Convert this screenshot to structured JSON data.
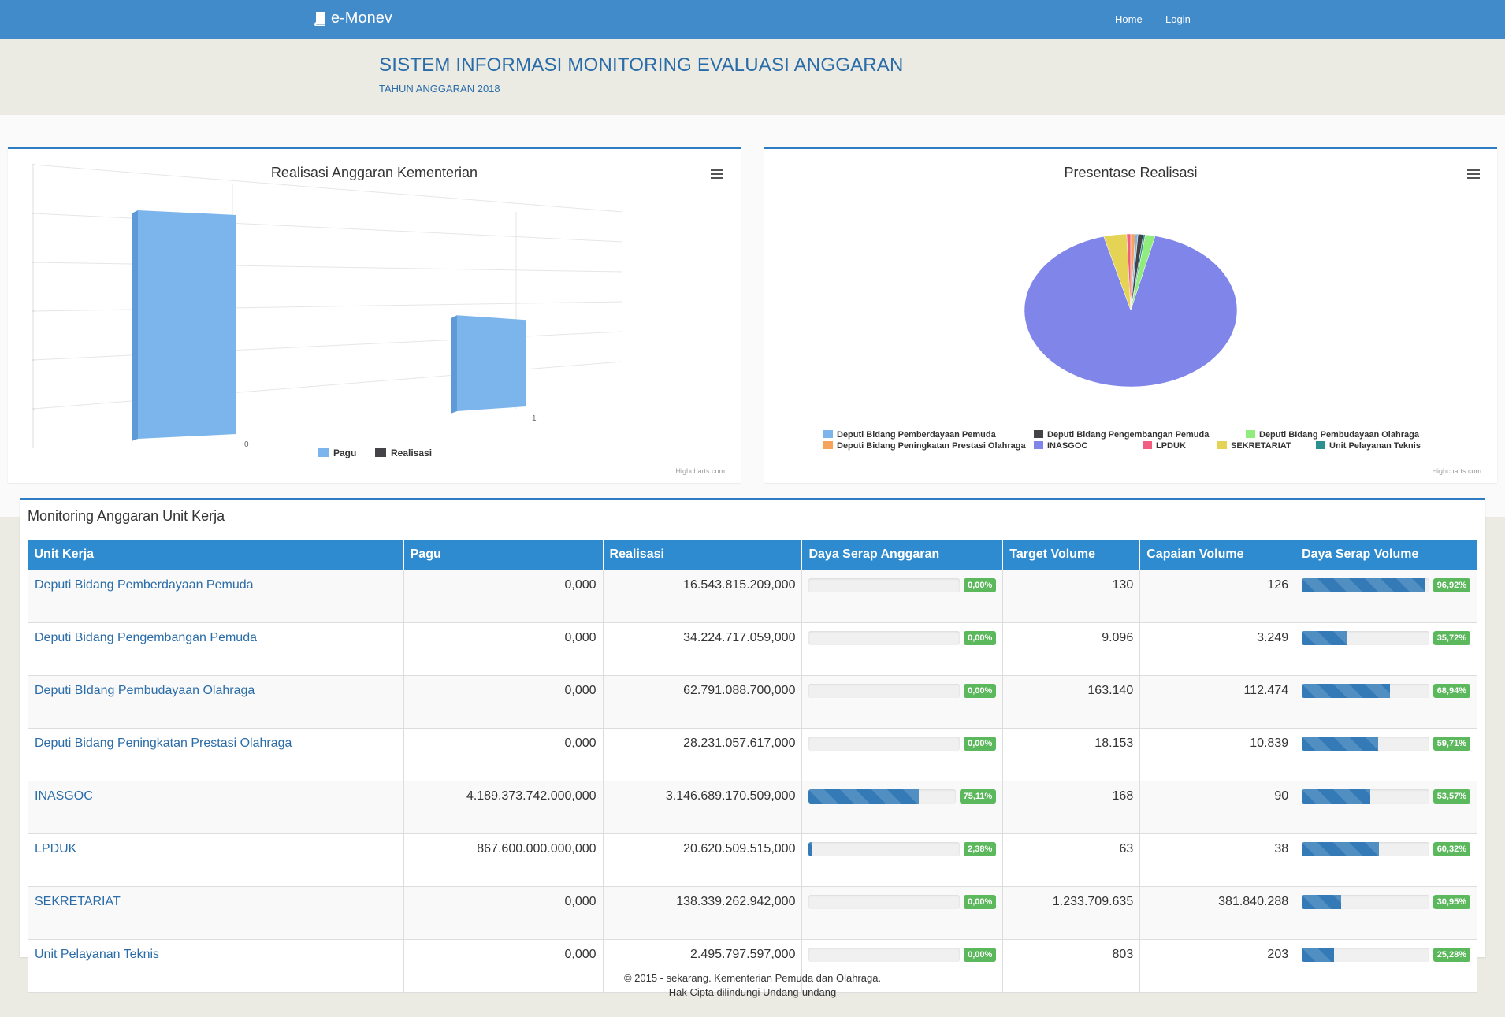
{
  "nav": {
    "brand": "e-Monev",
    "home": "Home",
    "login": "Login"
  },
  "header": {
    "title": "SISTEM INFORMASI MONITORING EVALUASI ANGGARAN",
    "subtitle": "TAHUN ANGGARAN 2018"
  },
  "chart_data": [
    {
      "type": "bar",
      "title": "Realisasi Anggaran Kementerian",
      "categories": [
        "0",
        "1"
      ],
      "series": [
        {
          "name": "Pagu",
          "color": "#7cb5ec",
          "values": [
            1.0,
            0
          ]
        },
        {
          "name": "Realisasi",
          "color": "#434348",
          "values": [
            0,
            0.6
          ]
        }
      ],
      "legend": "bottom-center",
      "credits": "Highcharts.com",
      "grid": true
    },
    {
      "type": "pie",
      "title": "Presentase Realisasi",
      "series": [
        {
          "name": "Deputi Bidang Pemberdayaan Pemuda",
          "color": "#7cb5ec",
          "value": 0.4
        },
        {
          "name": "Deputi Bidang Pengembangan Pemuda",
          "color": "#434348",
          "value": 0.8
        },
        {
          "name": "Deputi BIdang Pembudayaan Olahraga",
          "color": "#90ed7d",
          "value": 1.5
        },
        {
          "name": "Deputi Bidang Peningkatan Prestasi Olahraga",
          "color": "#f7a35c",
          "value": 0.7
        },
        {
          "name": "INASGOC",
          "color": "#8085e9",
          "value": 92.2
        },
        {
          "name": "LPDUK",
          "color": "#f15c80",
          "value": 0.6
        },
        {
          "name": "SEKRETARIAT",
          "color": "#e4d354",
          "value": 3.5
        },
        {
          "name": "Unit Pelayanan Teknis",
          "color": "#2b908f",
          "value": 0.3
        }
      ],
      "legend": "bottom-center",
      "credits": "Highcharts.com"
    }
  ],
  "table": {
    "title": "Monitoring Anggaran Unit Kerja",
    "headers": [
      "Unit Kerja",
      "Pagu",
      "Realisasi",
      "Daya Serap Anggaran",
      "Target Volume",
      "Capaian Volume",
      "Daya Serap Volume"
    ],
    "rows": [
      {
        "unit": "Deputi Bidang Pemberdayaan Pemuda",
        "pagu": "0,000",
        "realisasi": "16.543.815.209,000",
        "dsa": "0,00%",
        "dsa_pct": 0,
        "target": "130",
        "capaian": "126",
        "dsv": "96,92%",
        "dsv_pct": 96.92
      },
      {
        "unit": "Deputi Bidang Pengembangan Pemuda",
        "pagu": "0,000",
        "realisasi": "34.224.717.059,000",
        "dsa": "0,00%",
        "dsa_pct": 0,
        "target": "9.096",
        "capaian": "3.249",
        "dsv": "35,72%",
        "dsv_pct": 35.72
      },
      {
        "unit": "Deputi BIdang Pembudayaan Olahraga",
        "pagu": "0,000",
        "realisasi": "62.791.088.700,000",
        "dsa": "0,00%",
        "dsa_pct": 0,
        "target": "163.140",
        "capaian": "112.474",
        "dsv": "68,94%",
        "dsv_pct": 68.94
      },
      {
        "unit": "Deputi Bidang Peningkatan Prestasi Olahraga",
        "pagu": "0,000",
        "realisasi": "28.231.057.617,000",
        "dsa": "0,00%",
        "dsa_pct": 0,
        "target": "18.153",
        "capaian": "10.839",
        "dsv": "59,71%",
        "dsv_pct": 59.71
      },
      {
        "unit": "INASGOC",
        "pagu": "4.189.373.742.000,000",
        "realisasi": "3.146.689.170.509,000",
        "dsa": "75,11%",
        "dsa_pct": 75.11,
        "target": "168",
        "capaian": "90",
        "dsv": "53,57%",
        "dsv_pct": 53.57
      },
      {
        "unit": "LPDUK",
        "pagu": "867.600.000.000,000",
        "realisasi": "20.620.509.515,000",
        "dsa": "2,38%",
        "dsa_pct": 2.38,
        "target": "63",
        "capaian": "38",
        "dsv": "60,32%",
        "dsv_pct": 60.32
      },
      {
        "unit": "SEKRETARIAT",
        "pagu": "0,000",
        "realisasi": "138.339.262.942,000",
        "dsa": "0,00%",
        "dsa_pct": 0,
        "target": "1.233.709.635",
        "capaian": "381.840.288",
        "dsv": "30,95%",
        "dsv_pct": 30.95
      },
      {
        "unit": "Unit Pelayanan Teknis",
        "pagu": "0,000",
        "realisasi": "2.495.797.597,000",
        "dsa": "0,00%",
        "dsa_pct": 0,
        "target": "803",
        "capaian": "203",
        "dsv": "25,28%",
        "dsv_pct": 25.28
      }
    ]
  },
  "footer": {
    "line1": "© 2015 - sekarang. Kementerian Pemuda dan Olahraga.",
    "line2": "Hak Cipta dilindungi Undang-undang"
  }
}
